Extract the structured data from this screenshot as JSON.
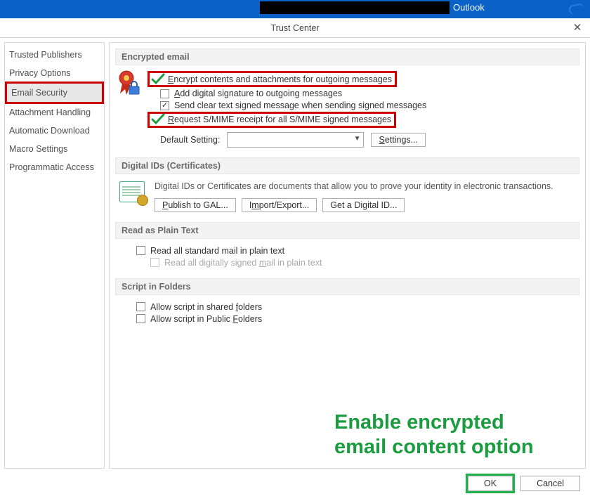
{
  "titlebar": {
    "app": "Outlook"
  },
  "dialog": {
    "title": "Trust Center"
  },
  "sidebar": {
    "items": [
      {
        "label": "Trusted Publishers"
      },
      {
        "label": "Privacy Options"
      },
      {
        "label": "Email Security",
        "selected": true,
        "highlight": true
      },
      {
        "label": "Attachment Handling"
      },
      {
        "label": "Automatic Download"
      },
      {
        "label": "Macro Settings"
      },
      {
        "label": "Programmatic Access"
      }
    ]
  },
  "sections": {
    "encrypted": {
      "title": "Encrypted email",
      "opts": {
        "encrypt": "Encrypt contents and attachments for outgoing messages",
        "sign": "Add digital signature to outgoing messages",
        "cleartext": "Send clear text signed message when sending signed messages",
        "receipt": "Request S/MIME receipt for all S/MIME signed messages"
      },
      "default_label": "Default Setting:",
      "default_value": "",
      "settings_btn": "Settings..."
    },
    "digids": {
      "title": "Digital IDs (Certificates)",
      "blurb": "Digital IDs or Certificates are documents that allow you to prove your identity in electronic transactions.",
      "btn_publish": "Publish to GAL...",
      "btn_import": "Import/Export...",
      "btn_get": "Get a Digital ID..."
    },
    "plain": {
      "title": "Read as Plain Text",
      "opt1": "Read all standard mail in plain text",
      "opt2": "Read all digitally signed mail in plain text"
    },
    "script": {
      "title": "Script in Folders",
      "opt1": "Allow script in shared folders",
      "opt2": "Allow script in Public Folders"
    }
  },
  "annotation": {
    "line1": "Enable encrypted",
    "line2": "email content option"
  },
  "footer": {
    "ok": "OK",
    "cancel": "Cancel"
  }
}
